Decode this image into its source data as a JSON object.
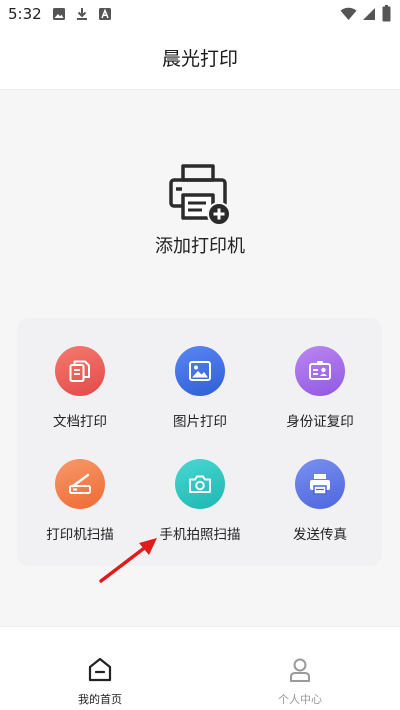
{
  "status_bar": {
    "time": "5:32",
    "icons": [
      "image-icon",
      "download-icon",
      "a-icon",
      "wifi-icon",
      "signal-icon",
      "battery-icon"
    ]
  },
  "app_bar": {
    "title": "晨光打印"
  },
  "add_printer": {
    "label": "添加打印机",
    "icon": "printer-add-icon"
  },
  "features": [
    {
      "label": "文档打印",
      "icon": "document-icon",
      "color": "#ec5a5a"
    },
    {
      "label": "图片打印",
      "icon": "image-icon",
      "color": "#3f6fe0"
    },
    {
      "label": "身份证复印",
      "icon": "id-card-icon",
      "color": "#a467e8"
    },
    {
      "label": "打印机扫描",
      "icon": "scanner-icon",
      "color": "#f47d48"
    },
    {
      "label": "手机拍照扫描",
      "icon": "camera-icon",
      "color": "#2dc7c2"
    },
    {
      "label": "发送传真",
      "icon": "fax-icon",
      "color": "#5b73e5"
    }
  ],
  "annotation": {
    "arrow_color": "#e01b1b"
  },
  "bottom_nav": {
    "items": [
      {
        "label": "我的首页",
        "icon": "home-icon",
        "active": true
      },
      {
        "label": "个人中心",
        "icon": "person-icon",
        "active": false
      }
    ],
    "active_color": "#222222",
    "inactive_color": "#9a9a9a"
  }
}
